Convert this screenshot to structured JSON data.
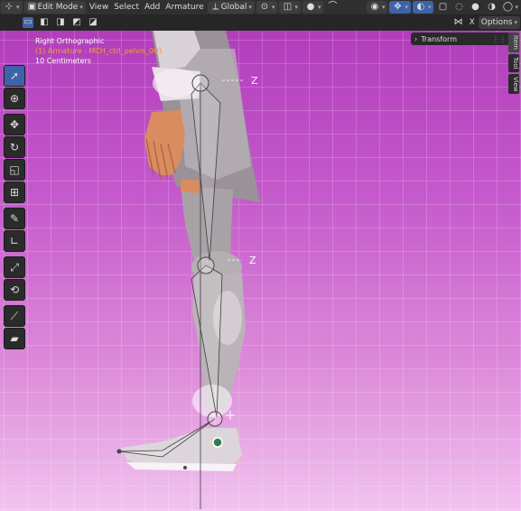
{
  "header": {
    "mode_label": "Edit Mode",
    "menus": [
      "View",
      "Select",
      "Add",
      "Armature"
    ],
    "transform_orientation": "Global",
    "options_label": "Options",
    "close_x": "X"
  },
  "viewport": {
    "view_name": "Right Orthographic",
    "object_info": "(1) Armature : MCH_ctrl_pelvis_001",
    "scale_info": "10 Centimeters",
    "axis_label": "Z"
  },
  "sidebar": {
    "panel_title": "Transform",
    "tabs": [
      "Item",
      "Tool",
      "View"
    ]
  },
  "colors": {
    "bg_top": "#b23dbc",
    "bg_bottom": "#f1c4ef",
    "active_tool": "#3d64a8",
    "object_text": "#f0a23a"
  },
  "icons": [
    "select-box-icon",
    "cursor-icon",
    "move-icon",
    "rotate-icon",
    "scale-icon",
    "transform-icon",
    "annotate-icon",
    "measure-icon",
    "bone-extrude-icon",
    "bone-roll-icon",
    "bone-envelope-icon",
    "bone-size-icon"
  ]
}
